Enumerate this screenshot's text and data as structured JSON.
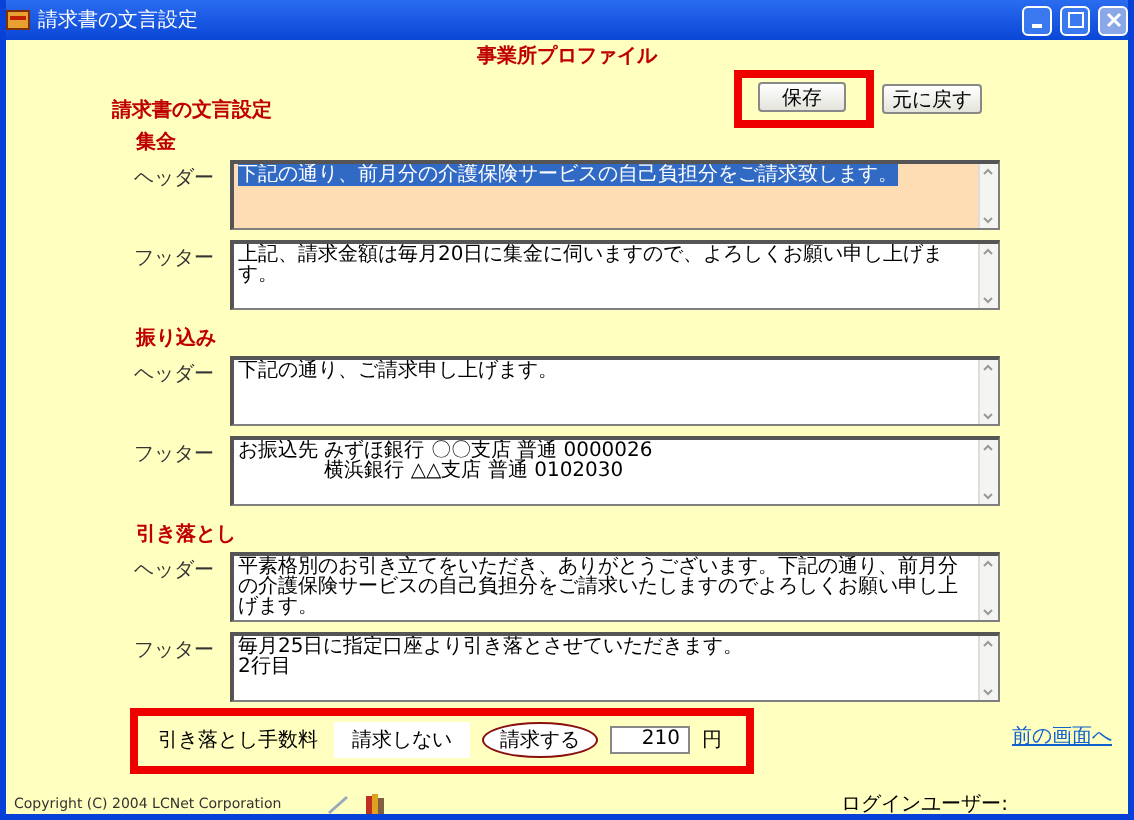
{
  "window": {
    "title": "請求書の文言設定"
  },
  "page_title": "事業所プロファイル",
  "section_title": "請求書の文言設定",
  "buttons": [
    {
      "label": "保存"
    },
    {
      "label": "元に戻す"
    }
  ],
  "groups": [
    {
      "title": "集金",
      "fields": [
        {
          "label": "ヘッダー",
          "lines": [
            "下記の通り、前月分の介護保険サービスの自己負担分をご請求致します。"
          ],
          "focused": true
        },
        {
          "label": "フッター",
          "lines": [
            "上記、請求金額は毎月20日に集金に伺いますので、よろしくお願い申し上げます。"
          ],
          "focused": false
        }
      ]
    },
    {
      "title": "振り込み",
      "fields": [
        {
          "label": "ヘッダー",
          "lines": [
            "下記の通り、ご請求申し上げます。"
          ],
          "focused": false
        },
        {
          "label": "フッター",
          "lines": [
            "お振込先 みずほ銀行 〇〇支店 普通 0000026",
            "　　　　 横浜銀行 △△支店 普通 0102030"
          ],
          "focused": false
        }
      ]
    },
    {
      "title": "引き落とし",
      "fields": [
        {
          "label": "ヘッダー",
          "lines": [
            "平素格別のお引き立てをいただき、ありがとうございます。下記の通り、前月分の介護保険サービスの自己負担分をご請求いたしますのでよろしくお願い申し上げます。"
          ],
          "focused": false
        },
        {
          "label": "フッター",
          "lines": [
            "毎月25日に指定口座より引き落とさせていただきます。",
            "2行目"
          ],
          "focused": false
        }
      ]
    }
  ],
  "fee": {
    "label": "引き落とし手数料",
    "options": [
      {
        "label": "請求しない",
        "selected": false
      },
      {
        "label": "請求する",
        "selected": true
      }
    ],
    "value": "210",
    "unit": "円"
  },
  "back_link": "前の画面へ",
  "copyright": "Copyright (C) 2004 LCNet Corporation",
  "login_label": "ログインユーザー:"
}
